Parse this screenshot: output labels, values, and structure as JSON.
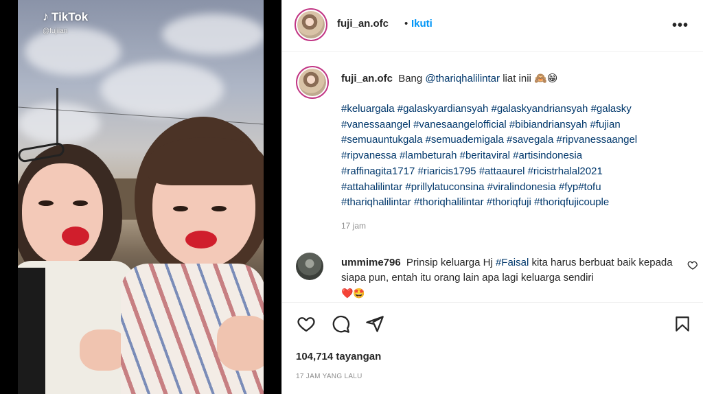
{
  "video": {
    "watermark_brand": "TikTok",
    "watermark_handle": "@fujiian"
  },
  "header": {
    "username": "fuji_an.ofc",
    "separator": "•",
    "follow_label": "Ikuti",
    "more_label": "•••"
  },
  "caption": {
    "username": "fuji_an.ofc",
    "text_before": "Bang",
    "mention": "@thariqhalilintar",
    "text_after": "liat inii 🙈😁",
    "hashtags_lines": [
      "#keluargala #galaskyardiansyah #galaskyandriansyah #galasky",
      "#vanessaangel #vanesaangelofficial #bibiandriansyah #fujian",
      "#semuauntukgala #semuademigala #savegala #ripvanessaangel",
      "#ripvanessa #lambeturah #beritaviral #artisindonesia",
      "#raffinagita1717 #riaricis1795 #attaaurel #ricistrhalal2021",
      "#attahalilintar #prillylatuconsina #viralindonesia #fyp#tofu",
      "#thariqhalilintar #thoriqhalilintar #thoriqfuji #thoriqfujicouple"
    ],
    "time": "17 jam"
  },
  "comment": {
    "username": "ummime796",
    "text_before": "Prinsip keluarga Hj",
    "hashtag": "#Faisal",
    "text_after": "kita harus berbuat baik kepada siapa pun, entah itu orang lain apa lagi keluarga sendiri",
    "emojis": "❤️🤩"
  },
  "actions": {
    "like_icon": "heart-outline",
    "comment_icon": "speech-bubble",
    "share_icon": "paper-plane",
    "save_icon": "bookmark",
    "views": "104,714 tayangan",
    "posted_ago": "17 JAM YANG LALU"
  },
  "colors": {
    "link": "#00376b",
    "follow": "#0095f6",
    "muted": "#8e8e8e",
    "text": "#262626"
  }
}
